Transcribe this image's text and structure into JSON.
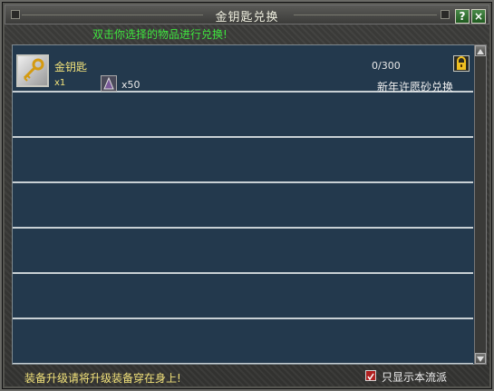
{
  "window": {
    "title": "金钥匙兑换",
    "help_label": "?",
    "close_label": "×"
  },
  "hint": "双击你选择的物品进行兑换!",
  "items": [
    {
      "name": "金钥匙",
      "count": "x1",
      "progress": "0/300",
      "required_icon": "sand-crystal-icon",
      "required_qty": "x50",
      "exchange_name": "新年许愿砂兑换",
      "icon": "golden-key-icon",
      "lock_icon": "lock-icon"
    }
  ],
  "empty_rows": 6,
  "status_text": "装备升级请将升级装备穿在身上!",
  "filter": {
    "label": "只显示本流派",
    "checked": true
  },
  "colors": {
    "hint": "#3ee63e",
    "list_bg": "#23394d",
    "item_text": "#f2e27a",
    "checkbox": "#b02020"
  }
}
